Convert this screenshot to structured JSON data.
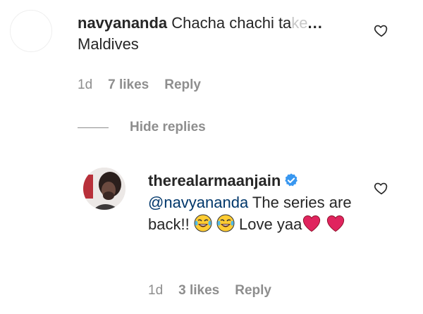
{
  "comment1": {
    "username": "navyananda",
    "text_visible": "Chacha chachi ta",
    "text_faded": "ke",
    "ellipsis": "...",
    "text_line2": "Maldives",
    "time": "1d",
    "likes": "7 likes",
    "reply": "Reply"
  },
  "hide_replies": "Hide replies",
  "comment2": {
    "username": "therealarmaanjain",
    "mention": "@navyananda",
    "text_a": " The series are back!! ",
    "text_b": " Love yaa",
    "time": "1d",
    "likes": "3 likes",
    "reply": "Reply"
  },
  "colors": {
    "link": "#00376b",
    "muted": "#8e8e8e",
    "verified": "#3897f0",
    "heart": "#e0245e"
  },
  "icons": [
    "heart-outline-icon",
    "verified-badge-icon",
    "tears-of-joy-emoji",
    "red-heart-emoji"
  ]
}
